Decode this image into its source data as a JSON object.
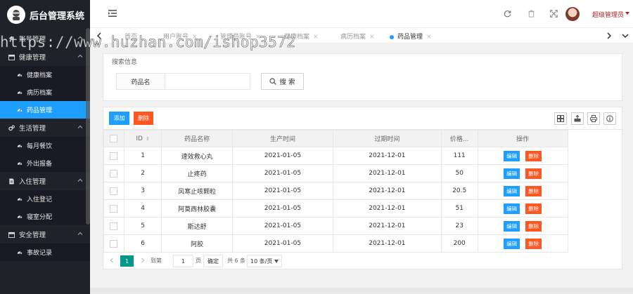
{
  "app": {
    "title": "后台管理系统"
  },
  "sidebar": {
    "groups": [
      {
        "label": "账号管理",
        "icon": "home-icon",
        "items": []
      },
      {
        "label": "健康管理",
        "icon": "calendar-icon",
        "items": [
          {
            "label": "健康档案",
            "active": false
          },
          {
            "label": "病历档案",
            "active": false
          },
          {
            "label": "药品管理",
            "active": true
          }
        ]
      },
      {
        "label": "生活管理",
        "icon": "gears-icon",
        "items": [
          {
            "label": "每月餐饮",
            "active": false
          },
          {
            "label": "外出报备",
            "active": false
          }
        ]
      },
      {
        "label": "入住管理",
        "icon": "document-icon",
        "items": [
          {
            "label": "入住登记",
            "active": false
          },
          {
            "label": "寝室分配",
            "active": false
          }
        ]
      },
      {
        "label": "安全管理",
        "icon": "calendar-icon",
        "items": [
          {
            "label": "事故记录",
            "active": false
          }
        ]
      }
    ]
  },
  "header": {
    "username": "超级管理员"
  },
  "tabs": [
    {
      "label": "首页",
      "closable": false,
      "active": false
    },
    {
      "label": "用户账号",
      "closable": true,
      "active": false
    },
    {
      "label": "管理员账号",
      "closable": true,
      "active": false
    },
    {
      "label": "健康档案",
      "closable": true,
      "active": false
    },
    {
      "label": "病历档案",
      "closable": true,
      "active": false
    },
    {
      "label": "药品管理",
      "closable": true,
      "active": true
    }
  ],
  "watermark": "https://www.huzhan.com/ishop3572",
  "search": {
    "section_title": "搜索信息",
    "field_label": "药品名",
    "field_value": "",
    "button_label": "搜 索"
  },
  "toolbar": {
    "add_label": "添加",
    "delete_label": "删除"
  },
  "table": {
    "columns": [
      "ID",
      "药品名称",
      "生产时间",
      "过期时间",
      "价格...",
      "操作"
    ],
    "edit_label": "编辑",
    "delete_label": "删除",
    "rows": [
      {
        "id": "1",
        "name": "速效救心丸",
        "produced": "2021-01-05",
        "expires": "2021-12-01",
        "price": "111"
      },
      {
        "id": "2",
        "name": "止疼药",
        "produced": "2021-01-05",
        "expires": "2021-12-01",
        "price": "50"
      },
      {
        "id": "3",
        "name": "风寒止咳颗粒",
        "produced": "2021-01-05",
        "expires": "2021-12-01",
        "price": "20.5"
      },
      {
        "id": "4",
        "name": "阿莫西林胶囊",
        "produced": "2021-01-05",
        "expires": "2021-12-01",
        "price": "51"
      },
      {
        "id": "5",
        "name": "斯达舒",
        "produced": "2021-01-05",
        "expires": "2021-12-01",
        "price": "23"
      },
      {
        "id": "6",
        "name": "阿胶",
        "produced": "2021-01-05",
        "expires": "2021-12-01",
        "price": "200"
      }
    ]
  },
  "pager": {
    "current_page": "1",
    "goto_prefix": "到第",
    "goto_value": "1",
    "goto_suffix": "页",
    "confirm_label": "确定",
    "total_label": "共 6 条",
    "page_size": "10 条/页"
  },
  "colors": {
    "sidebar_bg": "#20222a",
    "accent": "#1e9fff",
    "danger": "#ff5722",
    "pager_active": "#009688",
    "username": "#b22222"
  }
}
